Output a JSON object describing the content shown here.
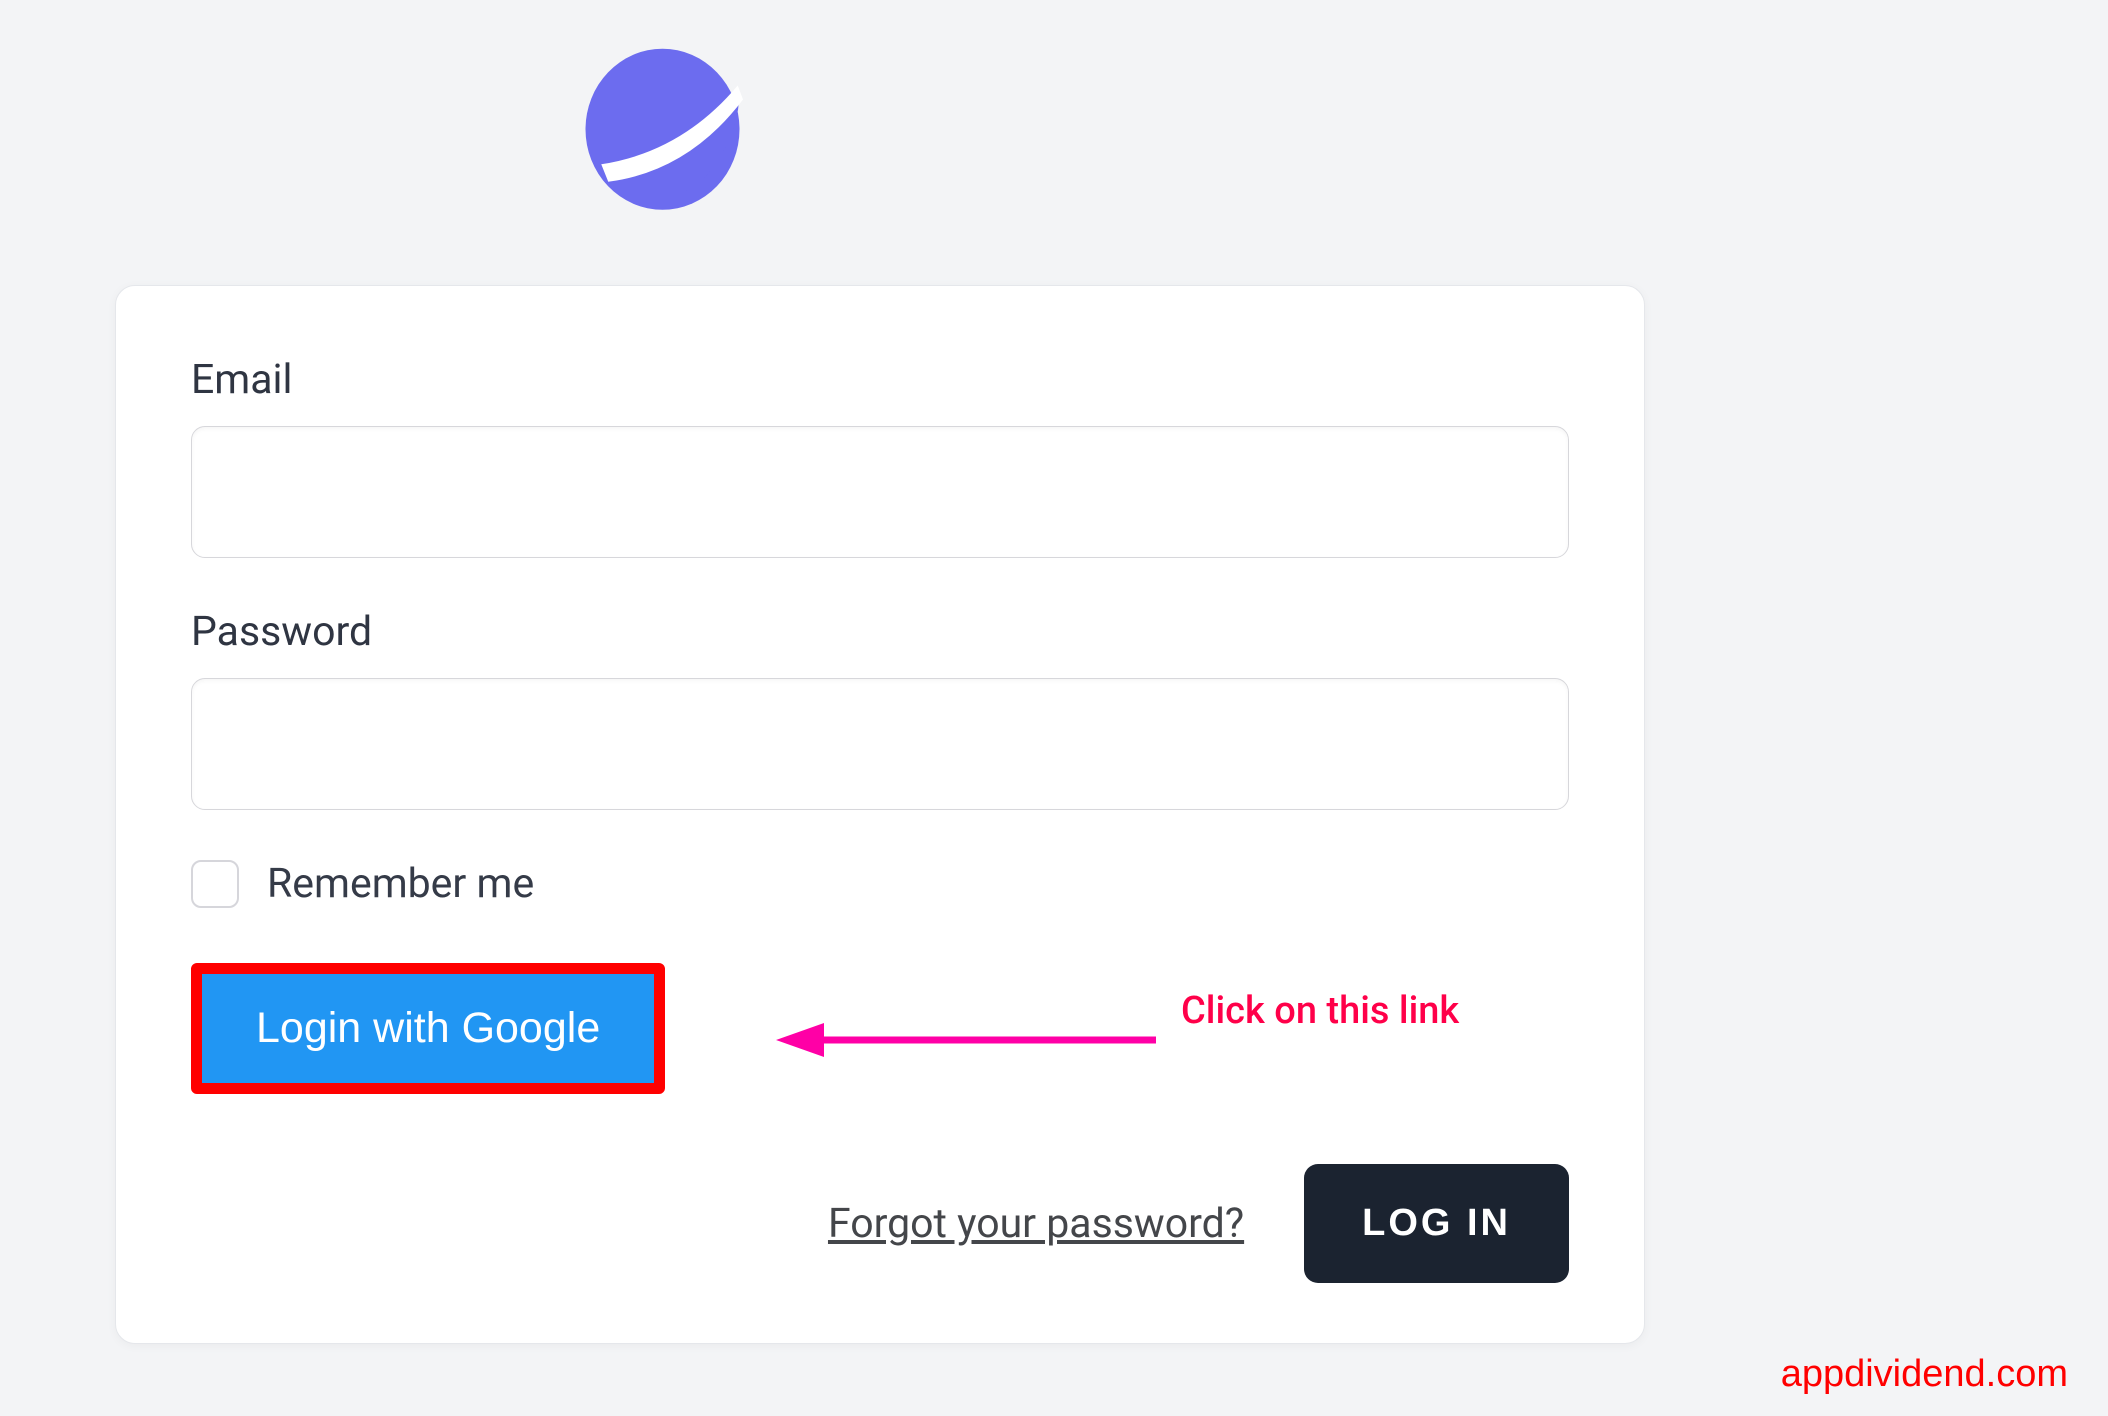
{
  "form": {
    "email_label": "Email",
    "email_value": "",
    "password_label": "Password",
    "password_value": "",
    "remember_label": "Remember me",
    "google_button": "Login with Google",
    "forgot_link": "Forgot your password?",
    "login_button": "LOG IN"
  },
  "annotation": {
    "text": "Click on this link"
  },
  "watermark": "appdividend.com",
  "colors": {
    "brand": "#6c6cef",
    "highlight_border": "#ff0000",
    "google_button_bg": "#2196f3",
    "login_button_bg": "#1b2330",
    "annotation_pink": "#ff00a6",
    "annotation_text": "#ff0049"
  }
}
